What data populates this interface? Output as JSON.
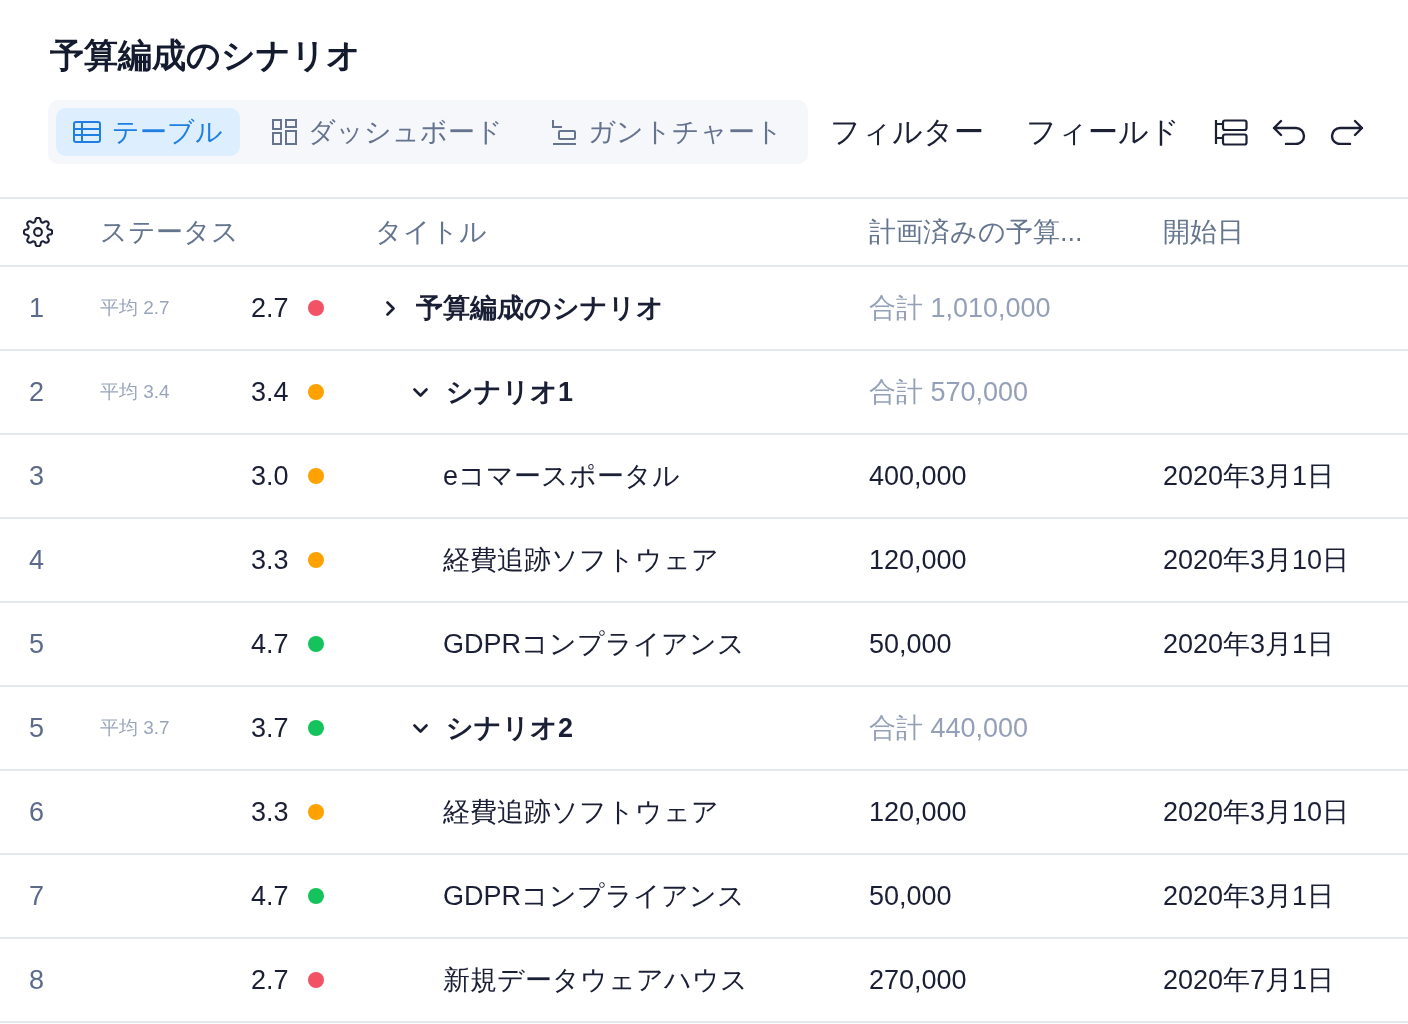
{
  "title": "予算編成のシナリオ",
  "view_tabs": [
    {
      "kind": "table",
      "label": "テーブル",
      "selected": true
    },
    {
      "kind": "dashboard",
      "label": "ダッシュボード",
      "selected": false
    },
    {
      "kind": "gantt",
      "label": "ガントチャート",
      "selected": false
    }
  ],
  "toolbar": [
    "フィルター",
    "フィールド"
  ],
  "table": {
    "columns": [
      "ステータス",
      "タイトル",
      "計画済みの予算...",
      "開始日"
    ],
    "rows": [
      {
        "kind": "group",
        "number": "1",
        "average": "平均 2.7",
        "score": "2.7",
        "color": "#f25264",
        "title": "予算編成のシナリオ",
        "expanded": false,
        "budget": "合計 1,010,000",
        "children": [
          {
            "kind": "group",
            "number": "2",
            "average": "平均 3.4",
            "score": "3.4",
            "color": "#ffa200",
            "title": "シナリオ1",
            "expanded": true,
            "budget": "合計 570,000",
            "children": [
              {
                "kind": "item",
                "number": "3",
                "score": "3.0",
                "color": "#ffa200",
                "title": "eコマースポータル",
                "budget": "400,000",
                "start_date": "2020年3月1日"
              },
              {
                "kind": "item",
                "number": "4",
                "score": "3.3",
                "color": "#ffa200",
                "title": "経費追跡ソフトウェア",
                "budget": "120,000",
                "start_date": "2020年3月10日"
              },
              {
                "kind": "item",
                "number": "5",
                "score": "4.7",
                "color": "#14c35c",
                "title": "GDPRコンプライアンス",
                "budget": "50,000",
                "start_date": "2020年3月1日"
              }
            ]
          },
          {
            "kind": "group",
            "number": "5",
            "average": "平均 3.7",
            "score": "3.7",
            "color": "#14c35c",
            "title": "シナリオ2",
            "expanded": true,
            "budget": "合計 440,000",
            "children": [
              {
                "kind": "item",
                "number": "6",
                "score": "3.3",
                "color": "#ffa200",
                "title": "経費追跡ソフトウェア",
                "budget": "120,000",
                "start_date": "2020年3月10日"
              },
              {
                "kind": "item",
                "number": "7",
                "score": "4.7",
                "color": "#14c35c",
                "title": "GDPRコンプライアンス",
                "budget": "50,000",
                "start_date": "2020年3月1日"
              },
              {
                "kind": "item",
                "number": "8",
                "score": "2.7",
                "color": "#f25264",
                "title": "新規データウェアハウス",
                "budget": "270,000",
                "start_date": "2020年7月1日"
              }
            ]
          }
        ]
      }
    ]
  }
}
